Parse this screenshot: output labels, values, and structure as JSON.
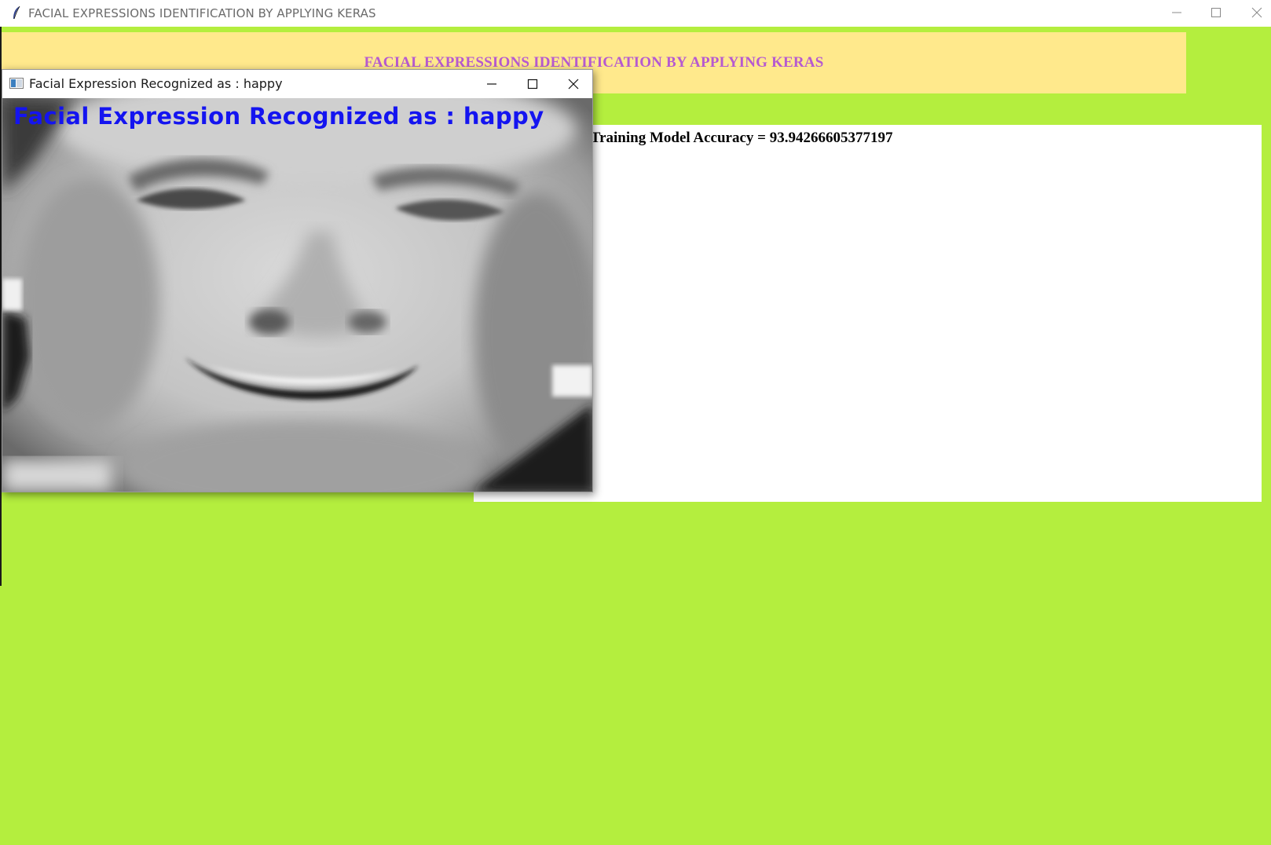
{
  "window": {
    "title": "FACIAL EXPRESSIONS IDENTIFICATION BY APPLYING KERAS",
    "app_icon": "feather-icon"
  },
  "header": {
    "title": "FACIAL EXPRESSIONS IDENTIFICATION BY APPLYING KERAS"
  },
  "output": {
    "text": "s Training Model Accuracy = 93.94266605377197"
  },
  "popup": {
    "title": "Facial Expression Recognized as : happy",
    "overlay_text": "Facial Expression Recognized as : happy",
    "image_alt": "grayscale face photo (smiling)"
  },
  "colors": {
    "background": "#b4ee3e",
    "banner": "#ffe98c",
    "banner_text": "#b65ad0",
    "overlay_text": "#1414f0"
  }
}
